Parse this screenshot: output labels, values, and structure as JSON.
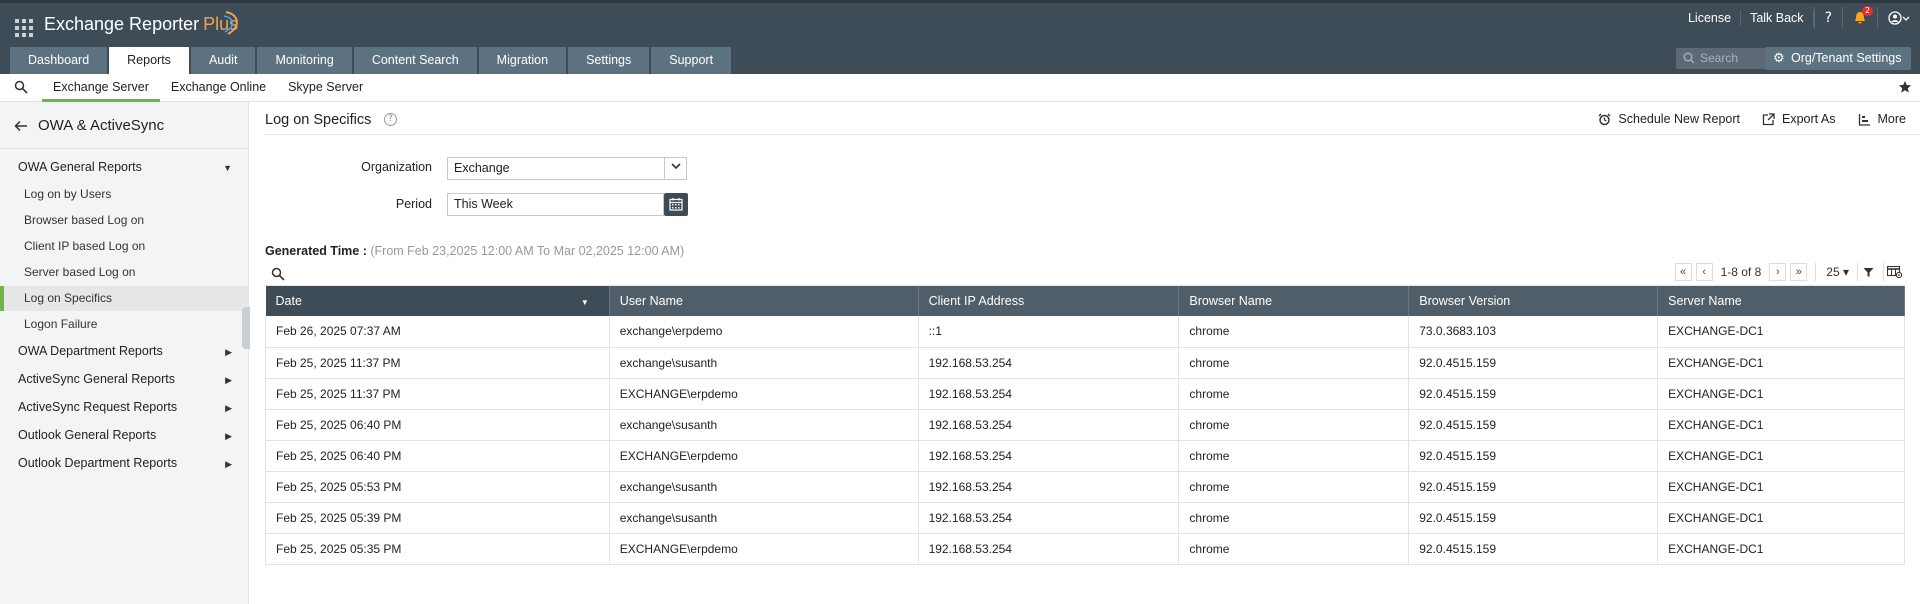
{
  "app": {
    "brand_name": "Exchange Reporter",
    "brand_plus": "Plus"
  },
  "header": {
    "links": [
      "License",
      "Talk Back"
    ],
    "notification_count": "2",
    "search_placeholder": "Search",
    "org_settings_label": "Org/Tenant Settings"
  },
  "nav": {
    "tabs": [
      {
        "label": "Dashboard",
        "active": false
      },
      {
        "label": "Reports",
        "active": true
      },
      {
        "label": "Audit",
        "active": false
      },
      {
        "label": "Monitoring",
        "active": false
      },
      {
        "label": "Content Search",
        "active": false
      },
      {
        "label": "Migration",
        "active": false
      },
      {
        "label": "Settings",
        "active": false
      },
      {
        "label": "Support",
        "active": false
      }
    ]
  },
  "subnav": {
    "tabs": [
      {
        "label": "Exchange Server",
        "active": true
      },
      {
        "label": "Exchange Online",
        "active": false
      },
      {
        "label": "Skype Server",
        "active": false
      }
    ]
  },
  "sidebar": {
    "title": "OWA & ActiveSync",
    "sections": [
      {
        "label": "OWA General Reports",
        "expanded": true,
        "items": [
          "Log on by Users",
          "Browser based Log on",
          "Client IP based Log on",
          "Server based Log on",
          "Log on Specifics",
          "Logon Failure"
        ],
        "active_item": "Log on Specifics"
      },
      {
        "label": "OWA Department Reports",
        "expanded": false
      },
      {
        "label": "ActiveSync General Reports",
        "expanded": false
      },
      {
        "label": "ActiveSync Request Reports",
        "expanded": false
      },
      {
        "label": "Outlook General Reports",
        "expanded": false
      },
      {
        "label": "Outlook Department Reports",
        "expanded": false
      }
    ]
  },
  "page": {
    "title": "Log on Specifics",
    "actions": [
      "Schedule New Report",
      "Export As",
      "More"
    ],
    "organization_label": "Organization",
    "organization_value": "Exchange",
    "period_label": "Period",
    "period_value": "This Week",
    "generated_label": "Generated Time :",
    "generated_range": "(From Feb 23,2025 12:00 AM To Mar 02,2025 12:00 AM)"
  },
  "pager": {
    "range_text": "1-8 of 8",
    "page_size": "25"
  },
  "table": {
    "columns": [
      "Date",
      "User Name",
      "Client IP Address",
      "Browser Name",
      "Browser Version",
      "Server Name"
    ],
    "rows": [
      [
        "Feb 26, 2025 07:37 AM",
        "exchange\\erpdemo",
        "::1",
        "chrome",
        "73.0.3683.103",
        "EXCHANGE-DC1"
      ],
      [
        "Feb 25, 2025 11:37 PM",
        "exchange\\susanth",
        "192.168.53.254",
        "chrome",
        "92.0.4515.159",
        "EXCHANGE-DC1"
      ],
      [
        "Feb 25, 2025 11:37 PM",
        "EXCHANGE\\erpdemo",
        "192.168.53.254",
        "chrome",
        "92.0.4515.159",
        "EXCHANGE-DC1"
      ],
      [
        "Feb 25, 2025 06:40 PM",
        "exchange\\susanth",
        "192.168.53.254",
        "chrome",
        "92.0.4515.159",
        "EXCHANGE-DC1"
      ],
      [
        "Feb 25, 2025 06:40 PM",
        "EXCHANGE\\erpdemo",
        "192.168.53.254",
        "chrome",
        "92.0.4515.159",
        "EXCHANGE-DC1"
      ],
      [
        "Feb 25, 2025 05:53 PM",
        "exchange\\susanth",
        "192.168.53.254",
        "chrome",
        "92.0.4515.159",
        "EXCHANGE-DC1"
      ],
      [
        "Feb 25, 2025 05:39 PM",
        "exchange\\susanth",
        "192.168.53.254",
        "chrome",
        "92.0.4515.159",
        "EXCHANGE-DC1"
      ],
      [
        "Feb 25, 2025 05:35 PM",
        "EXCHANGE\\erpdemo",
        "192.168.53.254",
        "chrome",
        "92.0.4515.159",
        "EXCHANGE-DC1"
      ]
    ]
  },
  "colors": {
    "header_bg": "#3e4c58",
    "tab_bg": "#5d7281",
    "accent_green": "#6fb445",
    "table_header_bg": "#4f5e69",
    "brand_plus": "#f0a44a"
  }
}
